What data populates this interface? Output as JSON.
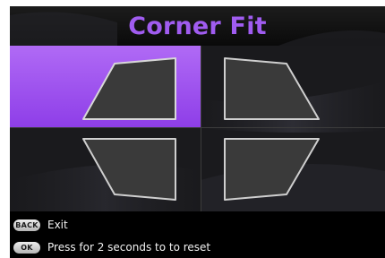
{
  "title": "Corner Fit",
  "corners": [
    {
      "name": "top-left",
      "selected": true
    },
    {
      "name": "top-right",
      "selected": false
    },
    {
      "name": "bottom-left",
      "selected": false
    },
    {
      "name": "bottom-right",
      "selected": false
    }
  ],
  "hints": [
    {
      "key": "BACK",
      "text": "Exit"
    },
    {
      "key": "OK",
      "text": "Press for 2 seconds to to reset"
    }
  ],
  "colors": {
    "accent": "#a05cf0",
    "selected_tile": "#9a4cee",
    "shape_fill": "#3a3a3a",
    "shape_stroke": "#cfcfcf"
  }
}
